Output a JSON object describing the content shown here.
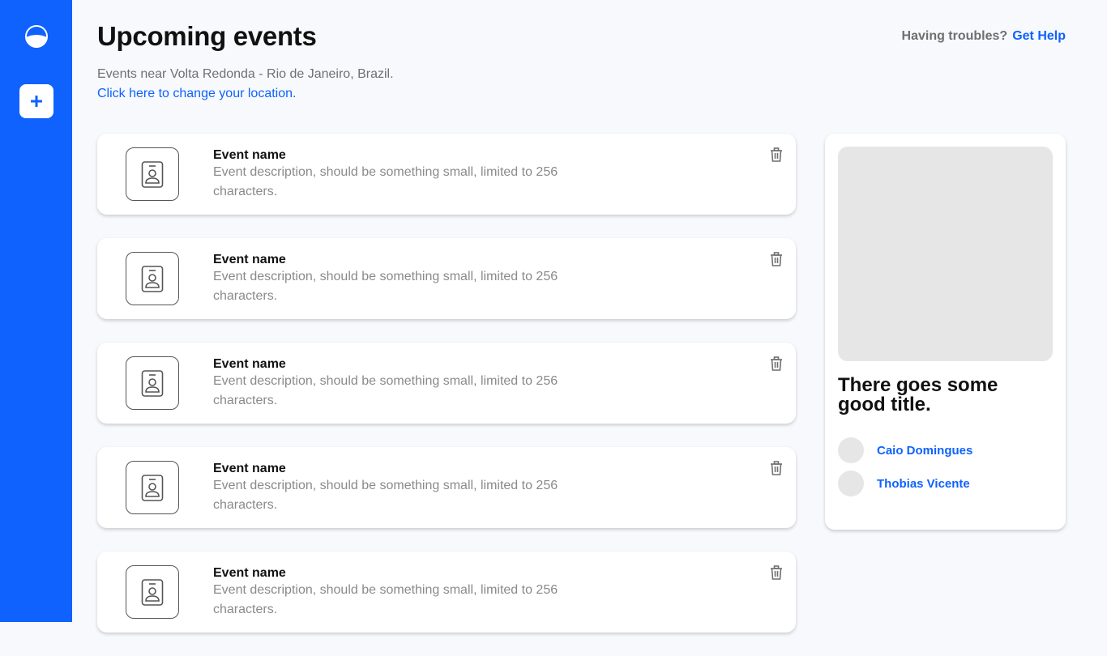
{
  "sidebar": {
    "logo_icon": "half-circle-logo-icon",
    "add_button_icon": "plus-icon"
  },
  "header": {
    "title": "Upcoming events",
    "help_text": "Having troubles?",
    "help_link": "Get Help"
  },
  "location": {
    "text": "Events near Volta Redonda - Rio de Janeiro, Brazil.",
    "change_link": "Click here to change your location."
  },
  "events": [
    {
      "name": "Event name",
      "description": "Event description, should be something small, limited to 256 characters."
    },
    {
      "name": "Event name",
      "description": "Event description, should be something small, limited to 256 characters."
    },
    {
      "name": "Event name",
      "description": "Event description, should be something small, limited to 256 characters."
    },
    {
      "name": "Event name",
      "description": "Event description, should be something small, limited to 256 characters."
    },
    {
      "name": "Event name",
      "description": "Event description, should be something small, limited to 256 characters."
    }
  ],
  "feature": {
    "title": "There goes some good title.",
    "people": [
      "Caio Domingues",
      "Thobias Vicente"
    ]
  },
  "colors": {
    "brand": "#0f62fe",
    "background": "#f7f9fd",
    "placeholder": "#e6e6e6"
  }
}
